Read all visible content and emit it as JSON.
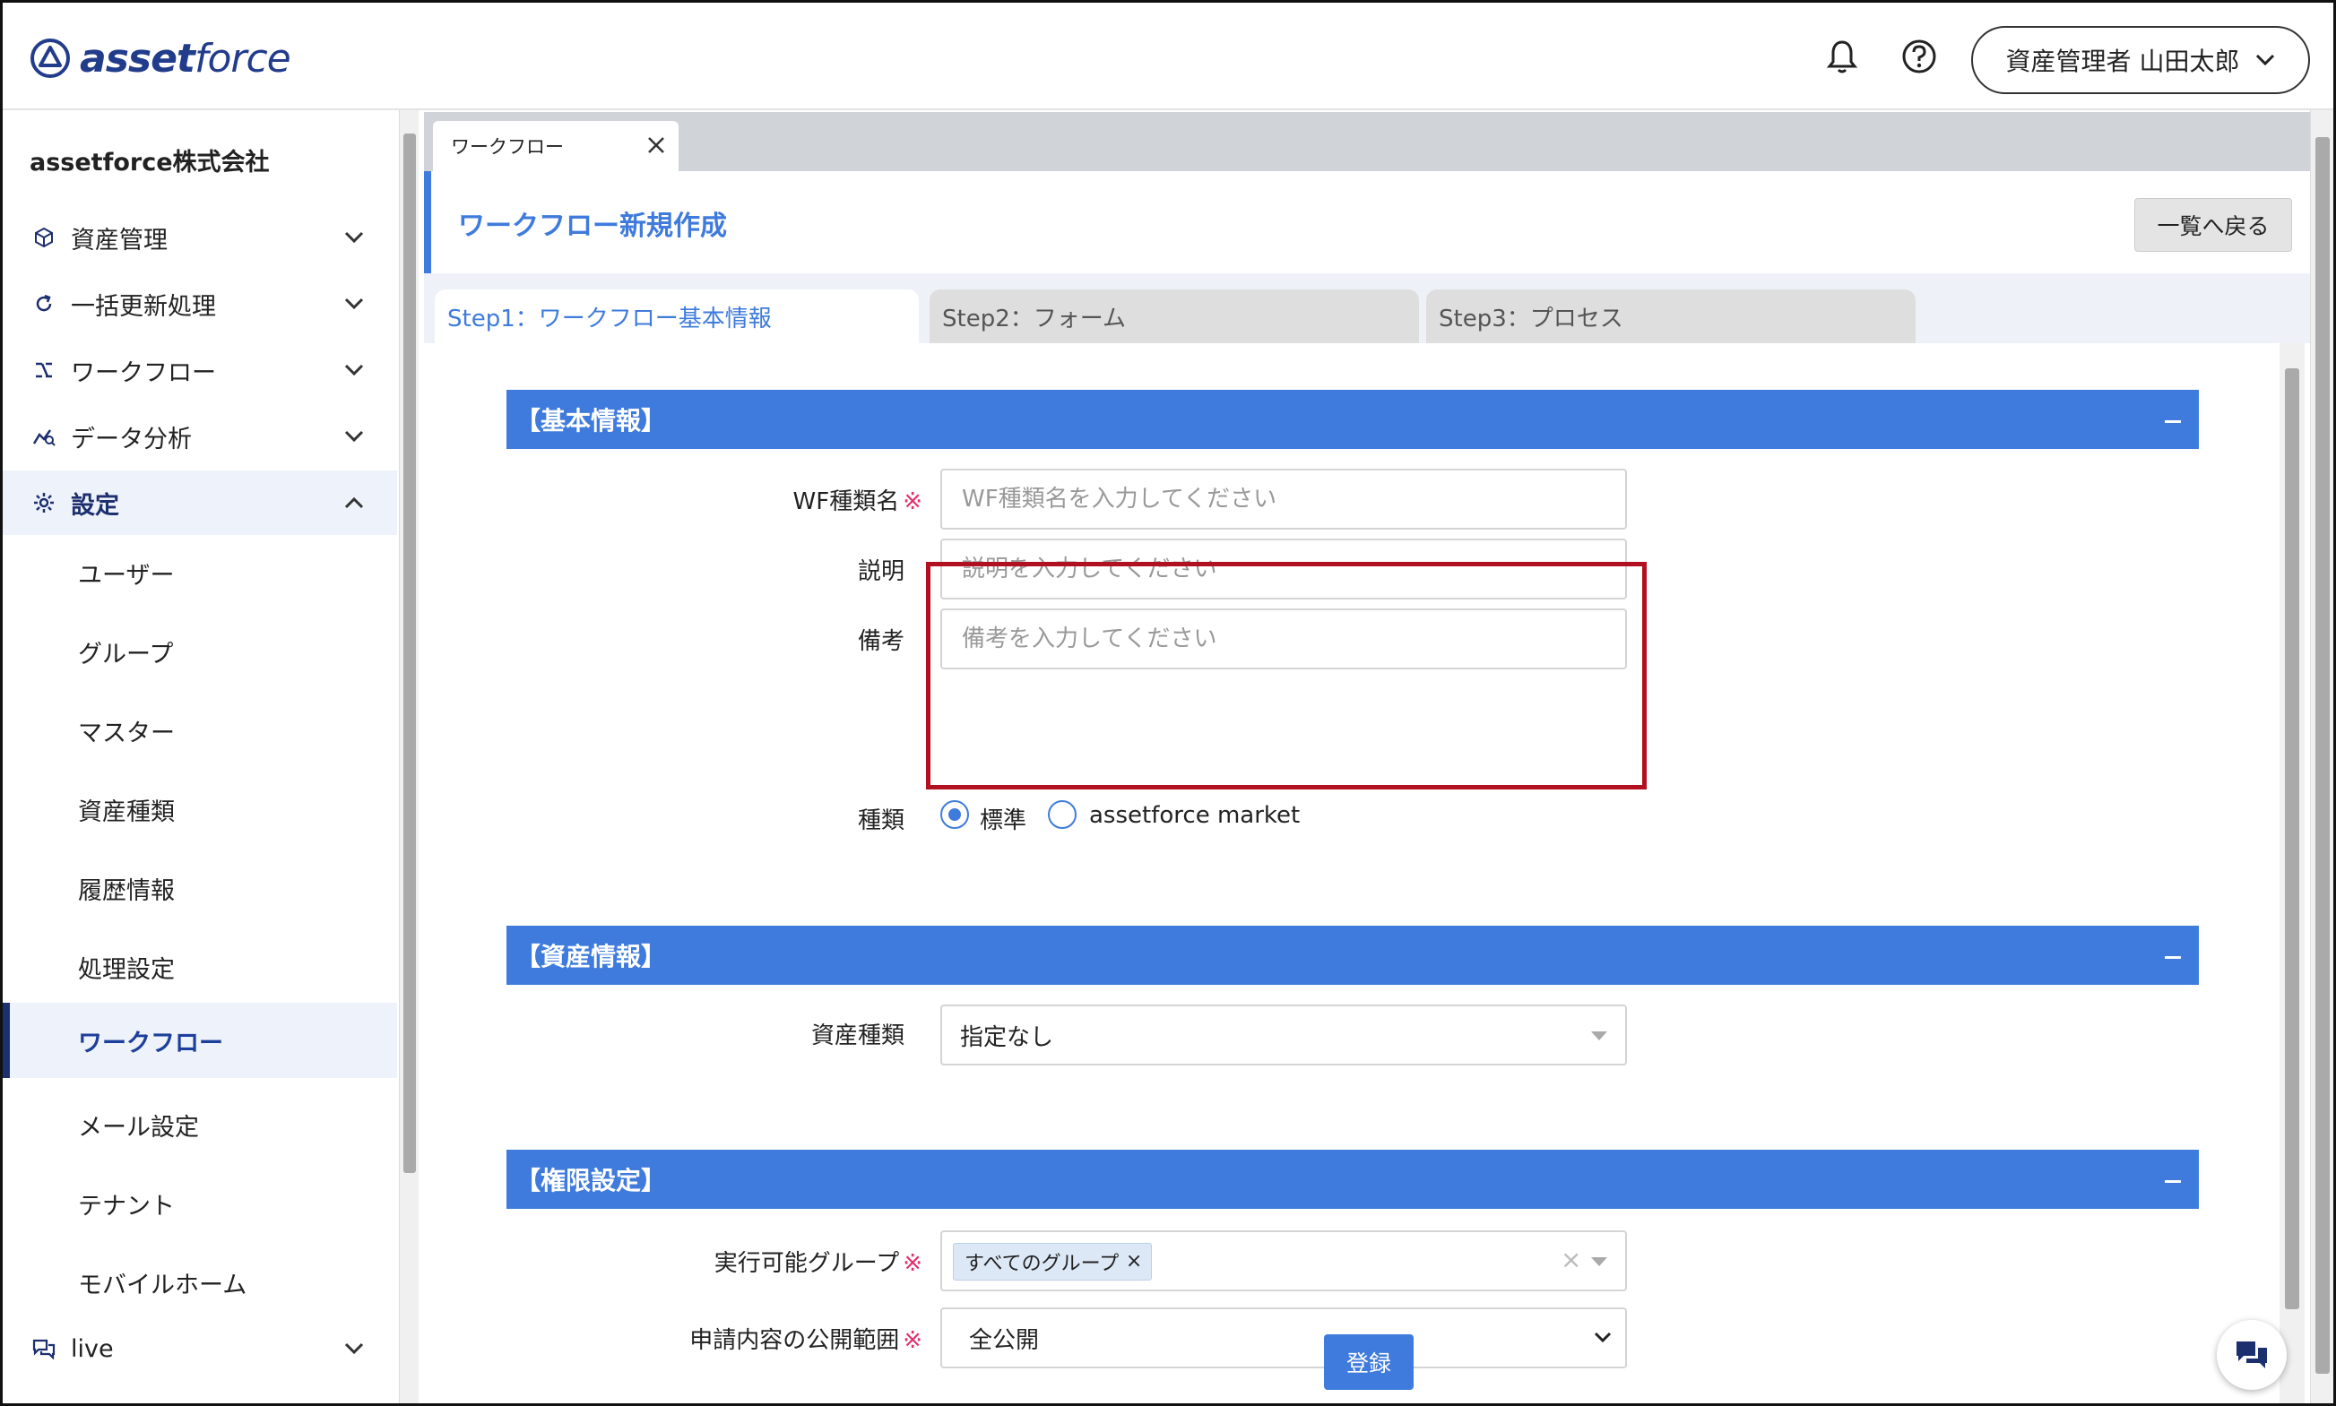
{
  "header": {
    "logo_bold": "asset",
    "logo_light": "force",
    "user_label": "資産管理者 山田太郎"
  },
  "sidebar": {
    "company": "assetforce株式会社",
    "items": [
      {
        "label": "資産管理",
        "icon": "cube-icon"
      },
      {
        "label": "一括更新処理",
        "icon": "refresh-icon"
      },
      {
        "label": "ワークフロー",
        "icon": "workflow-icon"
      },
      {
        "label": "データ分析",
        "icon": "chart-icon"
      },
      {
        "label": "設定",
        "icon": "gear-icon"
      },
      {
        "label": "live",
        "icon": "chat-bubbles-icon"
      }
    ],
    "sub_items": [
      "ユーザー",
      "グループ",
      "マスター",
      "資産種類",
      "履歴情報",
      "処理設定",
      "ワークフロー",
      "メール設定",
      "テナント",
      "モバイルホーム"
    ]
  },
  "tabbar": {
    "tab_label": "ワークフロー"
  },
  "page": {
    "title": "ワークフロー新規作成",
    "back_label": "一覧へ戻る"
  },
  "steps": [
    "Step1：ワークフロー基本情報",
    "Step2：フォーム",
    "Step3：プロセス"
  ],
  "basic": {
    "section_title": "【基本情報】",
    "wf_name_label": "WF種類名",
    "wf_name_placeholder": "WF種類名を入力してください",
    "desc_label": "説明",
    "desc_placeholder": "説明を入力してください",
    "note_label": "備考",
    "note_placeholder": "備考を入力してください",
    "type_label": "種類",
    "type_options": [
      "標準",
      "assetforce market"
    ]
  },
  "asset": {
    "section_title": "【資産情報】",
    "asset_type_label": "資産種類",
    "asset_type_value": "指定なし"
  },
  "perm": {
    "section_title": "【権限設定】",
    "exec_group_label": "実行可能グループ",
    "exec_group_tag": "すべてのグループ",
    "scope_label": "申請内容の公開範囲",
    "scope_value": "全公開"
  },
  "required_mark": "※",
  "submit_label": "登録",
  "colors": {
    "accent": "#3f7bdc",
    "brand": "#223c8c",
    "highlight": "#b01020",
    "required": "#e0306a"
  }
}
